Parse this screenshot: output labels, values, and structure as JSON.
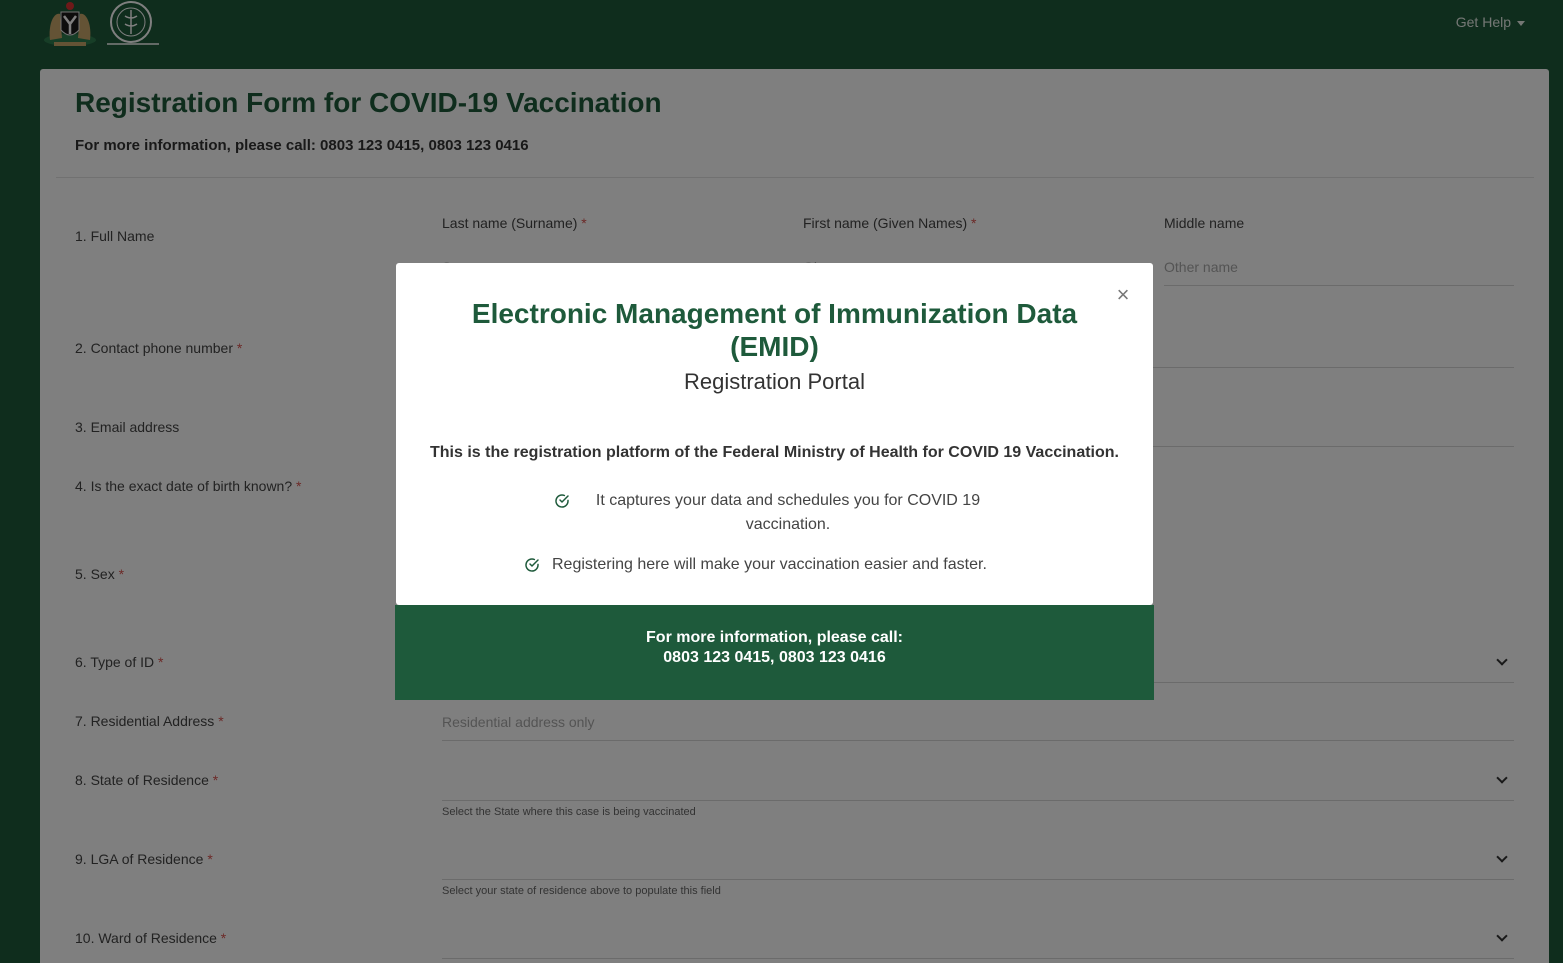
{
  "navbar": {
    "coat_of_arms_icon": "coat-of-arms-icon",
    "ministry_seal_icon": "ministry-seal-icon",
    "get_help_label": "Get Help"
  },
  "form": {
    "title": "Registration Form for COVID-19 Vaccination",
    "subtitle": "For more information, please call: 0803 123 0415, 0803 123 0416",
    "questions": [
      {
        "label": "1. Full Name",
        "required": false
      },
      {
        "label": "2. Contact phone number",
        "required": true
      },
      {
        "label": "3. Email address",
        "required": false
      },
      {
        "label": "4. Is the exact date of birth known?",
        "required": true
      },
      {
        "label": "5. Sex",
        "required": true
      },
      {
        "label": "6. Type of ID",
        "required": true
      },
      {
        "label": "7. Residential Address",
        "required": true
      },
      {
        "label": "8. State of Residence",
        "required": true
      },
      {
        "label": "9. LGA of Residence",
        "required": true
      },
      {
        "label": "10. Ward of Residence",
        "required": true
      }
    ],
    "full_name": {
      "last_name_label": "Last name (Surname)",
      "last_name_placeholder": "Surname",
      "first_name_label": "First name (Given Names)",
      "first_name_placeholder": "Given name",
      "middle_name_label": "Middle name",
      "middle_name_placeholder": "Other name"
    },
    "residential_address_placeholder": "Residential address only",
    "state_help": "Select the State where this case is being vaccinated",
    "lga_help": "Select your state of residence above to populate this field",
    "required_marker": "*"
  },
  "modal": {
    "title": "Electronic Management of Immunization Data (EMID)",
    "subtitle": "Registration Portal",
    "lead": "This is the registration platform of the Federal Ministry of Health for COVID 19 Vaccination.",
    "points": [
      "It captures your data and schedules you for COVID 19 vaccination.",
      "Registering here will make your vaccination easier and faster."
    ],
    "close_symbol": "×",
    "footer_line1": "For more information, please call:",
    "footer_line2": "0803 123 0415, 0803 123 0416"
  },
  "colors": {
    "brand_green": "#1e5a3b",
    "required_red": "#d9534f"
  }
}
